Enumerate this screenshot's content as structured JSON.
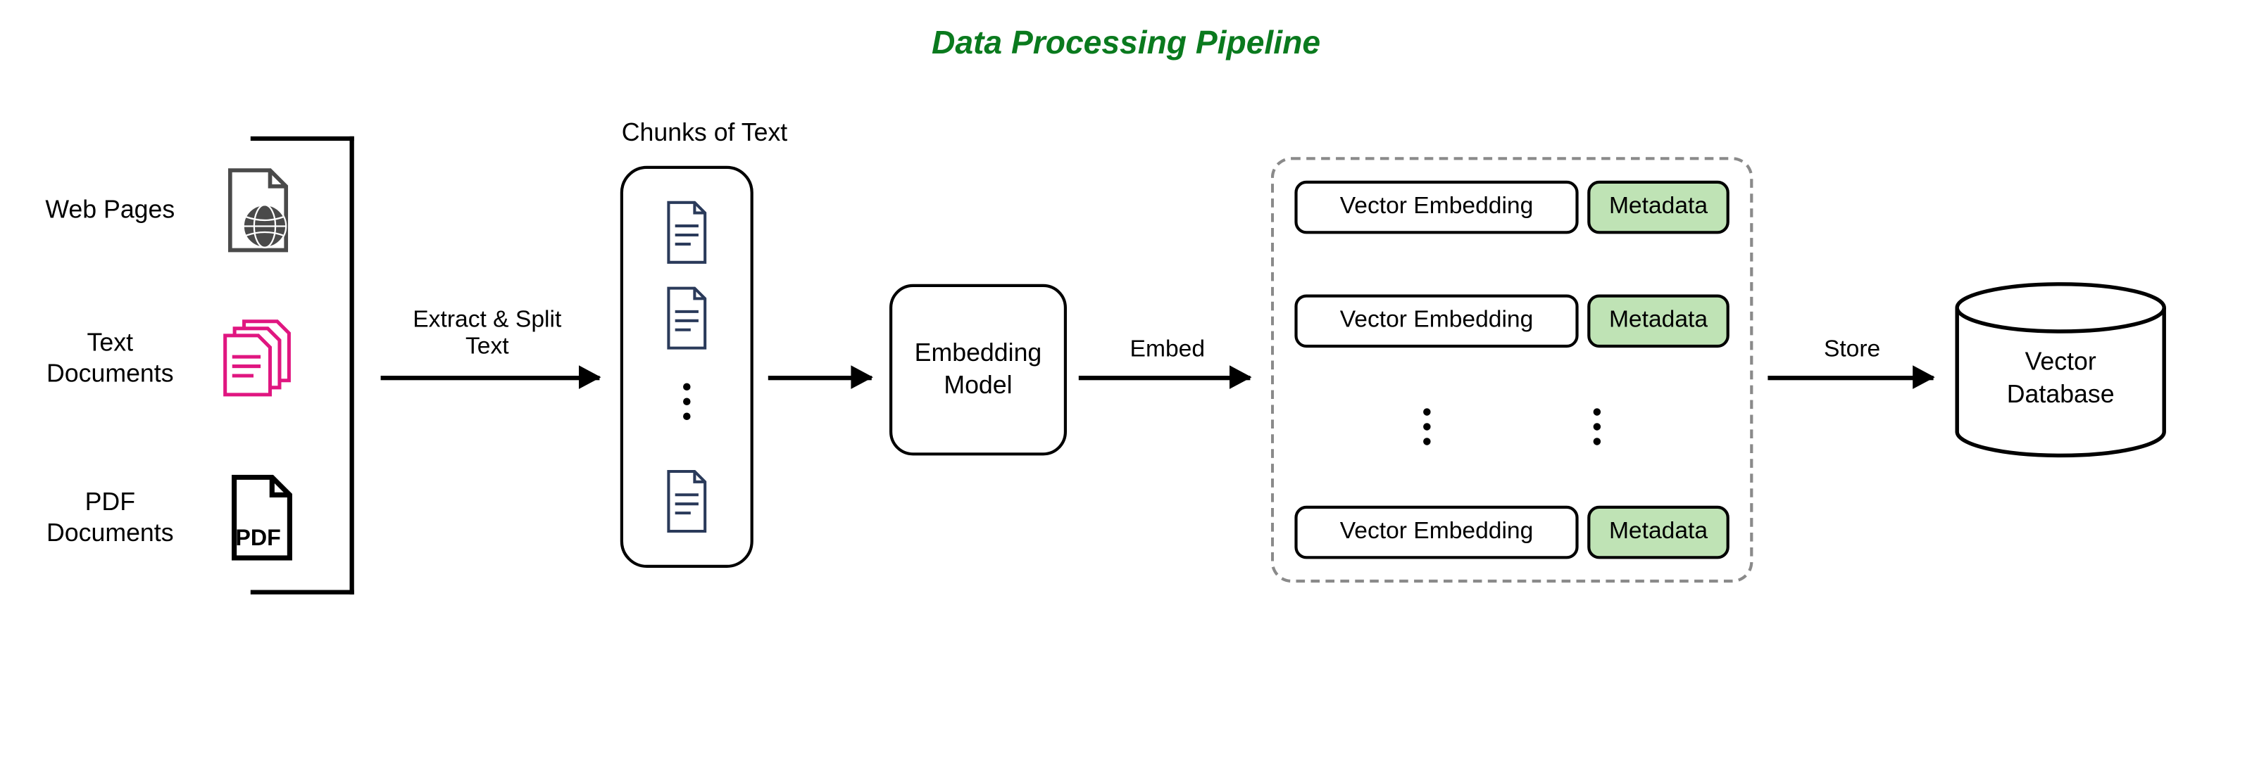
{
  "title": "Data Processing Pipeline",
  "sources": {
    "web": "Web Pages",
    "text": "Text\nDocuments",
    "pdf": "PDF\nDocuments"
  },
  "chunks_label": "Chunks of Text",
  "arrows": {
    "extract": "Extract & Split\nText",
    "embed": "Embed",
    "store": "Store"
  },
  "embedding_model": "Embedding\nModel",
  "embeddings": {
    "vector_label": "Vector Embedding",
    "metadata_label": "Metadata"
  },
  "cylinder_label": "Vector\nDatabase",
  "colors": {
    "title": "#0a7a1e",
    "metadata_bg": "#bfe3b5",
    "text_doc_icon": "#e01680"
  }
}
